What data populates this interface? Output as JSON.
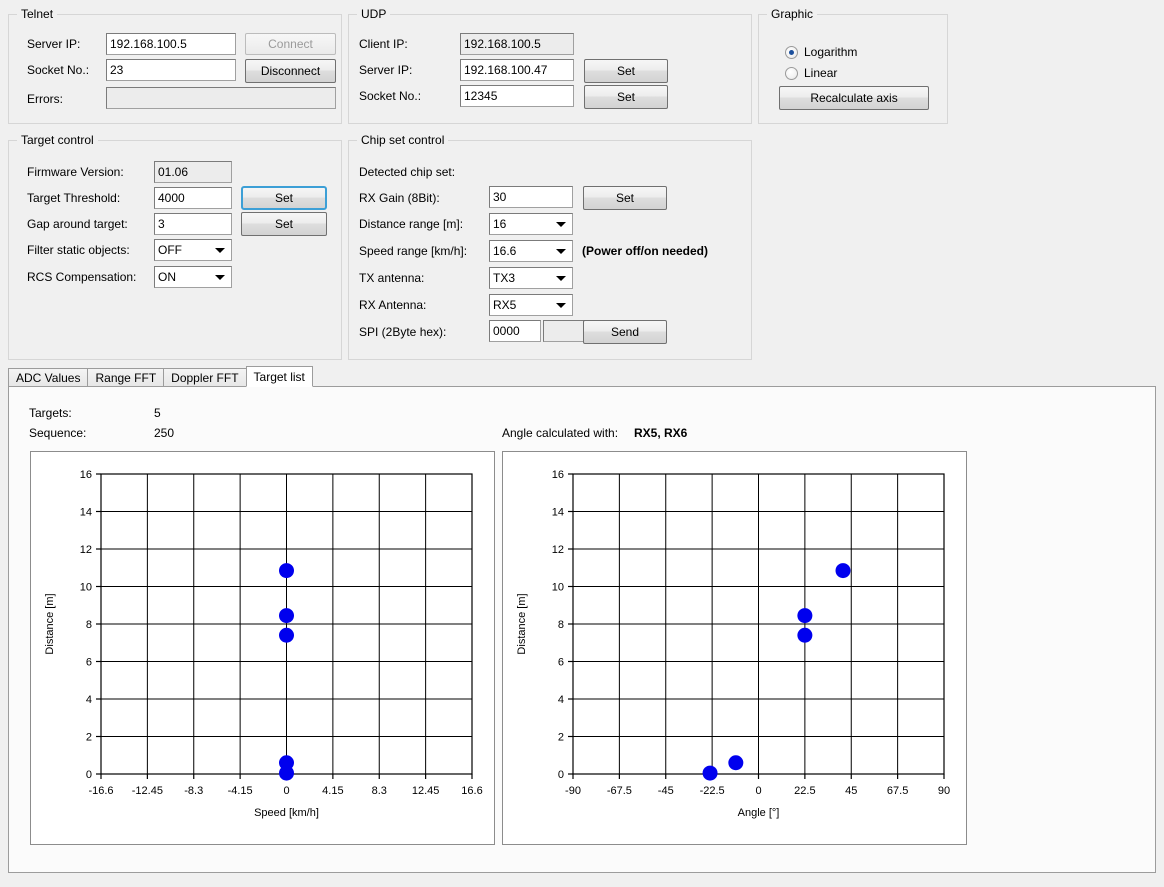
{
  "telnet": {
    "legend": "Telnet",
    "server_ip_label": "Server IP:",
    "server_ip_value": "192.168.100.5",
    "socket_label": "Socket No.:",
    "socket_value": "23",
    "errors_label": "Errors:",
    "errors_value": "",
    "connect_label": "Connect",
    "disconnect_label": "Disconnect"
  },
  "udp": {
    "legend": "UDP",
    "client_ip_label": "Client IP:",
    "client_ip_value": "192.168.100.5",
    "server_ip_label": "Server IP:",
    "server_ip_value": "192.168.100.47",
    "socket_label": "Socket No.:",
    "socket_value": "12345",
    "set_server_label": "Set",
    "set_socket_label": "Set"
  },
  "graphic": {
    "legend": "Graphic",
    "logarithm_label": "Logarithm",
    "linear_label": "Linear",
    "selected": "Logarithm",
    "recalculate_label": "Recalculate axis"
  },
  "target_control": {
    "legend": "Target control",
    "firmware_label": "Firmware Version:",
    "firmware_value": "01.06",
    "threshold_label": "Target Threshold:",
    "threshold_value": "4000",
    "threshold_set_label": "Set",
    "gap_label": "Gap around target:",
    "gap_value": "3",
    "gap_set_label": "Set",
    "filter_label": "Filter static objects:",
    "filter_value": "OFF",
    "rcs_label": "RCS Compensation:",
    "rcs_value": "ON"
  },
  "chip_set_control": {
    "legend": "Chip set control",
    "detected_label": "Detected chip set:",
    "detected_value": "",
    "rx_gain_label": "RX Gain (8Bit):",
    "rx_gain_value": "30",
    "rx_gain_set_label": "Set",
    "distance_range_label": "Distance range [m]:",
    "distance_range_value": "16",
    "speed_range_label": "Speed range [km/h]:",
    "speed_range_value": "16.6",
    "speed_range_note": "(Power off/on needed)",
    "tx_antenna_label": "TX antenna:",
    "tx_antenna_value": "TX3",
    "rx_antenna_label": "RX Antenna:",
    "rx_antenna_value": "RX5",
    "spi_label": "SPI (2Byte hex):",
    "spi_value": "0000",
    "spi_result_value": "",
    "send_label": "Send"
  },
  "tabs": [
    {
      "label": "ADC Values",
      "active": false
    },
    {
      "label": "Range FFT",
      "active": false
    },
    {
      "label": "Doppler FFT",
      "active": false
    },
    {
      "label": "Target list",
      "active": true
    }
  ],
  "target_list": {
    "targets_label": "Targets:",
    "targets_value": "5",
    "sequence_label": "Sequence:",
    "sequence_value": "250",
    "angle_calc_label": "Angle calculated with:",
    "angle_calc_value": "RX5, RX6"
  },
  "colors": {
    "marker": "#0000ee",
    "window_bg": "#f0f0f0",
    "panel_bg": "#fbfbfb",
    "axis": "#000000",
    "focus": "#3c9fd6"
  },
  "chart_data": [
    {
      "type": "scatter",
      "name": "speed-distance",
      "title": "",
      "xlabel": "Speed [km/h]",
      "ylabel": "Distance [m]",
      "xlim": [
        -16.6,
        16.6
      ],
      "ylim": [
        0,
        16
      ],
      "xticks": [
        -16.6,
        -12.45,
        -8.3,
        -4.15,
        0,
        4.15,
        8.3,
        12.45,
        16.6
      ],
      "xticklabels": [
        "-16.6",
        "-12.45",
        "-8.3",
        "-4.15",
        "0",
        "4.15",
        "8.3",
        "12.45",
        "16.6"
      ],
      "yticks": [
        0,
        2,
        4,
        6,
        8,
        10,
        12,
        14,
        16
      ],
      "yticklabels": [
        "0",
        "2",
        "4",
        "6",
        "8",
        "10",
        "12",
        "14",
        "16"
      ],
      "grid": true,
      "legend": false,
      "points": [
        {
          "x": 0,
          "y": 10.85
        },
        {
          "x": 0,
          "y": 8.45
        },
        {
          "x": 0,
          "y": 7.4
        },
        {
          "x": 0,
          "y": 0.6
        },
        {
          "x": 0,
          "y": 0.05
        }
      ]
    },
    {
      "type": "scatter",
      "name": "angle-distance",
      "title": "",
      "xlabel": "Angle [°]",
      "ylabel": "Distance [m]",
      "xlim": [
        -90,
        90
      ],
      "ylim": [
        0,
        16
      ],
      "xticks": [
        -90,
        -67.5,
        -45,
        -22.5,
        0,
        22.5,
        45,
        67.5,
        90
      ],
      "xticklabels": [
        "-90",
        "-67.5",
        "-45",
        "-22.5",
        "0",
        "22.5",
        "45",
        "67.5",
        "90"
      ],
      "yticks": [
        0,
        2,
        4,
        6,
        8,
        10,
        12,
        14,
        16
      ],
      "yticklabels": [
        "0",
        "2",
        "4",
        "6",
        "8",
        "10",
        "12",
        "14",
        "16"
      ],
      "grid": true,
      "legend": false,
      "points": [
        {
          "x": 41.0,
          "y": 10.85
        },
        {
          "x": 22.5,
          "y": 8.45
        },
        {
          "x": 22.5,
          "y": 7.4
        },
        {
          "x": -11.0,
          "y": 0.6
        },
        {
          "x": -23.5,
          "y": 0.05
        }
      ]
    }
  ]
}
